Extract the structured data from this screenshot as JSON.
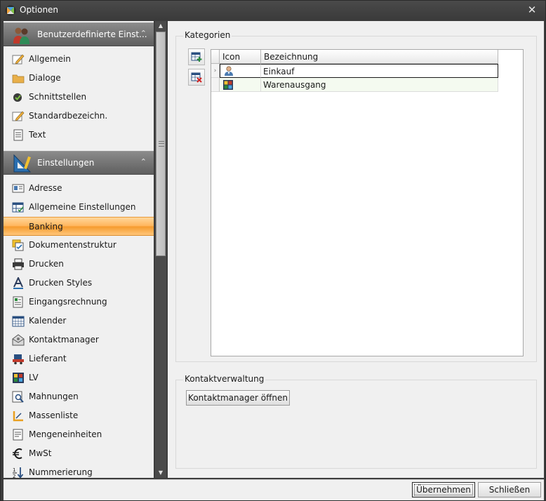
{
  "window": {
    "title": "Optionen",
    "close_glyph": "✕"
  },
  "nav": {
    "groups": [
      {
        "label": "Benutzerdefinierte Einst...",
        "icon": "users-icon",
        "chevron": "⌃",
        "items": [
          {
            "label": "Allgemein",
            "icon": "pencil-paper-icon"
          },
          {
            "label": "Dialoge",
            "icon": "folder-icon"
          },
          {
            "label": "Schnittstellen",
            "icon": "plug-check-icon"
          },
          {
            "label": "Standardbezeichn.",
            "icon": "pencil-paper-icon"
          },
          {
            "label": "Text",
            "icon": "document-lines-icon"
          }
        ]
      },
      {
        "label": "Einstellungen",
        "icon": "ruler-triangle-icon",
        "chevron": "⌃",
        "items": [
          {
            "label": "Adresse",
            "icon": "address-card-icon"
          },
          {
            "label": "Allgemeine Einstellungen",
            "icon": "table-check-icon"
          },
          {
            "label": "Banking",
            "icon": "bank-icon",
            "selected": true
          },
          {
            "label": "Dokumentenstruktur",
            "icon": "document-stack-icon"
          },
          {
            "label": "Drucken",
            "icon": "printer-icon"
          },
          {
            "label": "Drucken Styles",
            "icon": "font-a-icon"
          },
          {
            "label": "Eingangsrechnung",
            "icon": "invoice-icon"
          },
          {
            "label": "Kalender",
            "icon": "calendar-icon"
          },
          {
            "label": "Kontaktmanager",
            "icon": "envelope-open-icon"
          },
          {
            "label": "Lieferant",
            "icon": "truck-icon"
          },
          {
            "label": "LV",
            "icon": "color-grid-icon"
          },
          {
            "label": "Mahnungen",
            "icon": "magnifier-doc-icon"
          },
          {
            "label": "Massenliste",
            "icon": "measure-icon"
          },
          {
            "label": "Mengeneinheiten",
            "icon": "list-doc-icon"
          },
          {
            "label": "MwSt",
            "icon": "euro-icon"
          },
          {
            "label": "Nummerierung",
            "icon": "sort-numbers-icon"
          }
        ]
      }
    ]
  },
  "kategorien": {
    "title": "Kategorien",
    "toolbar": [
      {
        "icon": "add-row-icon"
      },
      {
        "icon": "delete-row-icon"
      }
    ],
    "columns": [
      "Icon",
      "Bezeichnung"
    ],
    "rows": [
      {
        "icon": "person-icon",
        "bezeichnung": "Einkauf",
        "current": true,
        "indicator": "›"
      },
      {
        "icon": "color-grid-icon",
        "bezeichnung": "Warenausgang",
        "current": false,
        "indicator": ""
      }
    ]
  },
  "kontaktverwaltung": {
    "title": "Kontaktverwaltung",
    "button_label": "Kontaktmanager öffnen"
  },
  "footer": {
    "apply_label": "Übernehmen",
    "close_label": "Schließen"
  }
}
